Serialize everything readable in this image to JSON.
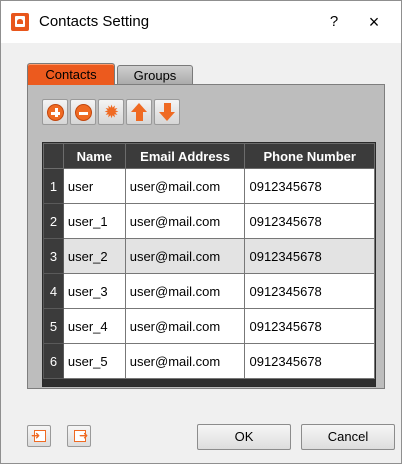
{
  "window": {
    "title": "Contacts Setting",
    "help_label": "?",
    "close_label": "×"
  },
  "tabs": [
    {
      "label": "Contacts",
      "active": true
    },
    {
      "label": "Groups",
      "active": false
    }
  ],
  "toolbar": {
    "buttons": [
      {
        "name": "add",
        "icon": "plus-circle-icon"
      },
      {
        "name": "remove",
        "icon": "minus-circle-icon"
      },
      {
        "name": "settings",
        "icon": "gear-icon"
      },
      {
        "name": "move-up",
        "icon": "arrow-up-icon"
      },
      {
        "name": "move-down",
        "icon": "arrow-down-icon"
      }
    ]
  },
  "table": {
    "columns": [
      "Name",
      "Email Address",
      "Phone Number"
    ],
    "rows": [
      {
        "num": "1",
        "name": "user",
        "email": "user@mail.com",
        "phone": "0912345678"
      },
      {
        "num": "2",
        "name": "user_1",
        "email": "user@mail.com",
        "phone": "0912345678"
      },
      {
        "num": "3",
        "name": "user_2",
        "email": "user@mail.com",
        "phone": "0912345678"
      },
      {
        "num": "4",
        "name": "user_3",
        "email": "user@mail.com",
        "phone": "0912345678"
      },
      {
        "num": "5",
        "name": "user_4",
        "email": "user@mail.com",
        "phone": "0912345678"
      },
      {
        "num": "6",
        "name": "user_5",
        "email": "user@mail.com",
        "phone": "0912345678"
      }
    ],
    "selected_row": 3
  },
  "footer": {
    "import_icon": "import-icon",
    "export_icon": "export-icon",
    "ok_label": "OK",
    "cancel_label": "Cancel"
  },
  "colors": {
    "accent": "#ec5a1e",
    "grid_header": "#3b3b3b",
    "panel": "#bdbdbd"
  }
}
